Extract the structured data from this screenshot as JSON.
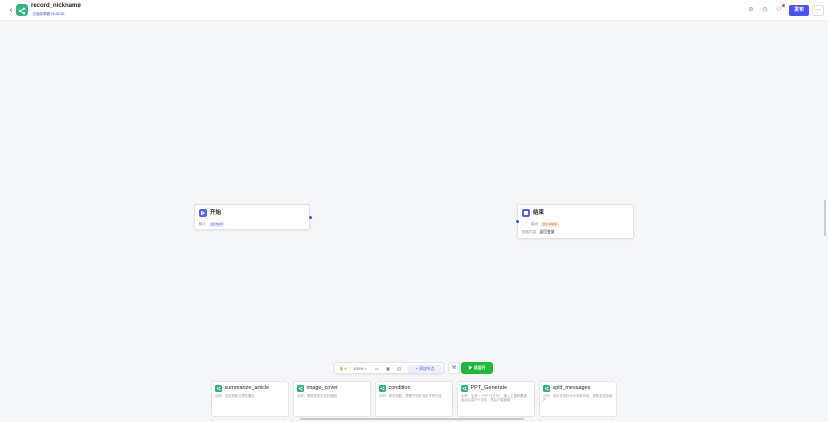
{
  "header": {
    "title": "record_nickname",
    "save_status": "已保存草稿 15:30:36",
    "publish_label": "发布",
    "more_label": "···"
  },
  "nodes": {
    "start": {
      "title": "开始",
      "input_label": "输入",
      "input_tag": "input"
    },
    "end": {
      "title": "结束",
      "output_label": "输出",
      "output_tag": "output",
      "answer_label": "回答内容",
      "answer_value": "返回变量"
    }
  },
  "toolbar": {
    "zoom": "100%",
    "add_node_label": "+ 添加节点",
    "run_label": "试运行"
  },
  "plugins": [
    {
      "title": "summarize_article",
      "desc": "示例：总结提取文章的要点"
    },
    {
      "title": "image_cover",
      "desc": "示例：根据描述生成封面图"
    },
    {
      "title": "condition",
      "desc": "示例：条件判断，根据不同情况走不同分支"
    },
    {
      "title": "PPT_Generate",
      "desc": "示例：生成一个PPT幻灯片，输入主题和要求，自动生成PPT文件，然后下载链接"
    },
    {
      "title": "split_messages",
      "desc": "示例：将长文本拆分为多条消息，逐条发送给用户"
    }
  ],
  "colors": {
    "accent": "#4d53e8",
    "run_green": "#1fb83a",
    "plugin_green": "#36b37e",
    "output_orange": "#d9692b"
  }
}
